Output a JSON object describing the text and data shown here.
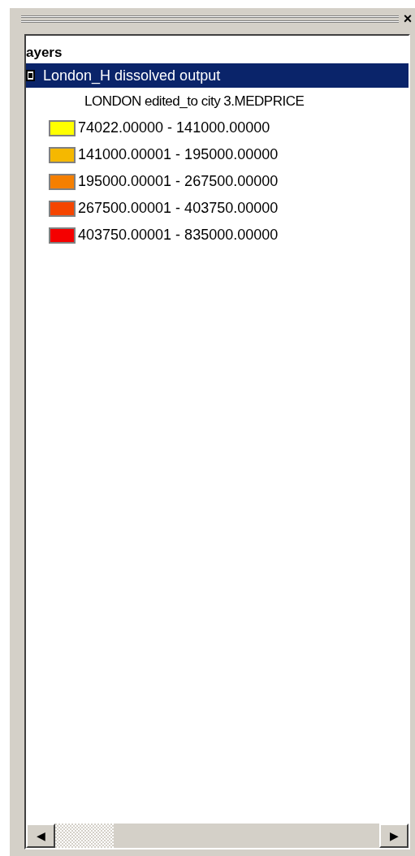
{
  "panel": {
    "close": "×"
  },
  "layers_header": "ayers",
  "layers": [
    {
      "name": "London_H dissolved output",
      "checked": true,
      "selected": true,
      "field": "LONDON edited_to city 3.MEDPRICE",
      "classes": [
        {
          "label": "74022.00000 - 141000.00000",
          "color": "#ffff00"
        },
        {
          "label": "141000.00001 - 195000.00000",
          "color": "#f5b800"
        },
        {
          "label": "195000.00001 - 267500.00000",
          "color": "#f57f00"
        },
        {
          "label": "267500.00001 - 403750.00000",
          "color": "#f54500"
        },
        {
          "label": "403750.00001 - 835000.00000",
          "color": "#f50000"
        }
      ]
    }
  ],
  "scrollbar": {
    "left": "◀",
    "right": "▶"
  }
}
